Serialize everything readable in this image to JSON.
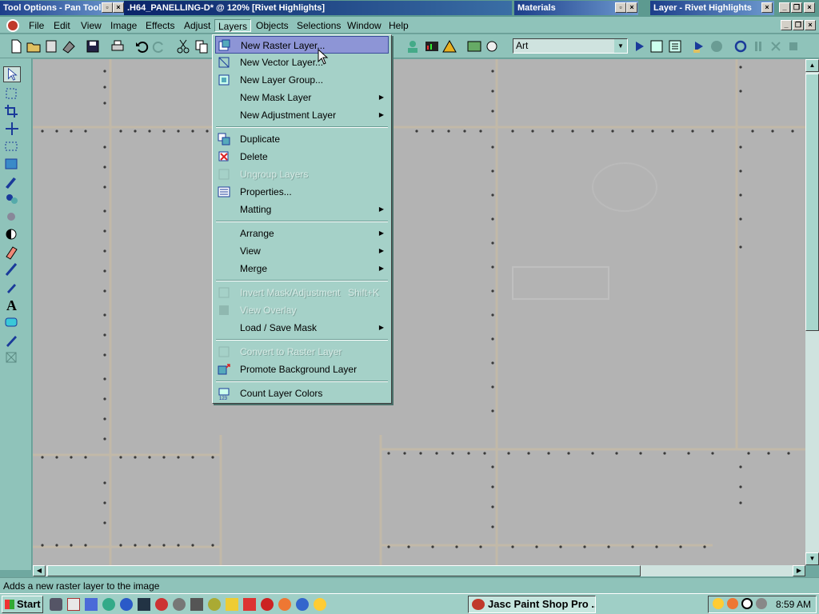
{
  "titlebar": {
    "tool_options": "Tool Options - Pan Tool",
    "document": ".H64_PANELLING-D* @ 120% [Rivet Highlights]",
    "materials": "Materials",
    "layer": "Layer - Rivet Highlights"
  },
  "menubar": {
    "items": [
      "File",
      "Edit",
      "View",
      "Image",
      "Effects",
      "Adjust",
      "Layers",
      "Objects",
      "Selections",
      "Window",
      "Help"
    ]
  },
  "toolbar": {
    "dropdown_value": "Art"
  },
  "layers_menu": {
    "items": [
      {
        "label": "New Raster Layer...",
        "icon": "raster-layer-icon",
        "highlighted": true
      },
      {
        "label": "New Vector Layer...",
        "icon": "vector-layer-icon"
      },
      {
        "label": "New Layer Group...",
        "icon": "layer-group-icon"
      },
      {
        "label": "New Mask Layer",
        "submenu": true
      },
      {
        "label": "New Adjustment Layer",
        "submenu": true
      },
      {
        "label": "Duplicate",
        "icon": "duplicate-icon"
      },
      {
        "label": "Delete",
        "icon": "delete-icon"
      },
      {
        "label": "Ungroup Layers",
        "icon": "ungroup-icon",
        "disabled": true
      },
      {
        "label": "Properties...",
        "icon": "properties-icon"
      },
      {
        "label": "Matting",
        "submenu": true
      },
      {
        "label": "Arrange",
        "submenu": true
      },
      {
        "label": "View",
        "submenu": true
      },
      {
        "label": "Merge",
        "submenu": true
      },
      {
        "label": "Invert Mask/Adjustment",
        "shortcut": "Shift+K",
        "icon": "invert-mask-icon",
        "disabled": true
      },
      {
        "label": "View Overlay",
        "icon": "overlay-icon",
        "disabled": true
      },
      {
        "label": "Load / Save Mask",
        "submenu": true
      },
      {
        "label": "Convert to Raster Layer",
        "icon": "convert-raster-icon",
        "disabled": true
      },
      {
        "label": "Promote Background Layer",
        "icon": "promote-background-icon"
      },
      {
        "label": "Count Layer Colors",
        "icon": "count-colors-icon"
      }
    ]
  },
  "statusbar": {
    "text": "Adds a new raster layer to the image"
  },
  "taskbar": {
    "start": "Start",
    "task": "Jasc Paint Shop Pro ...",
    "clock": "8:59 AM"
  },
  "colors": {
    "chrome": "#8fc3ba",
    "menu_bg": "#a5d1c8",
    "highlight": "#8d95d6",
    "canvas": "#b3b3b3"
  }
}
